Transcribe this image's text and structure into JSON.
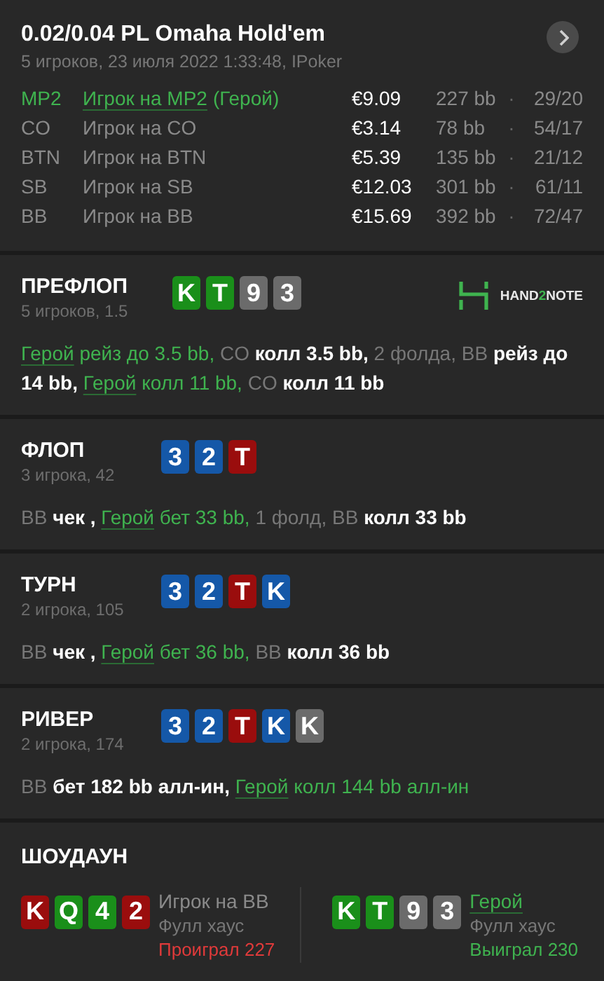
{
  "header": {
    "title": "0.02/0.04 PL Omaha Hold'em",
    "subtitle": "5 игроков, 23 июля 2022 1:33:48, IPoker"
  },
  "players": [
    {
      "position": "MP2",
      "name": "Игрок на MP2",
      "hero_tag": "(Герой)",
      "hero": true,
      "stack": "€9.09",
      "bb": "227 bb",
      "separator": "·",
      "stats": "29/20"
    },
    {
      "position": "CO",
      "name": "Игрок на CO",
      "hero": false,
      "stack": "€3.14",
      "bb": "78 bb",
      "separator": "·",
      "stats": "54/17"
    },
    {
      "position": "BTN",
      "name": "Игрок на BTN",
      "hero": false,
      "stack": "€5.39",
      "bb": "135 bb",
      "separator": "·",
      "stats": "21/12"
    },
    {
      "position": "SB",
      "name": "Игрок на SB",
      "hero": false,
      "stack": "€12.03",
      "bb": "301 bb",
      "separator": "·",
      "stats": "61/11"
    },
    {
      "position": "BB",
      "name": "Игрок на BB",
      "hero": false,
      "stack": "€15.69",
      "bb": "392 bb",
      "separator": "·",
      "stats": "72/47"
    }
  ],
  "logo": {
    "parts": [
      "HAND",
      "2",
      "NOTE"
    ]
  },
  "streets": [
    {
      "name": "ПРЕФЛОП",
      "info": "5 игроков, 1.5",
      "logo": true,
      "cards": [
        {
          "rank": "K",
          "color": "#1a8f1a"
        },
        {
          "rank": "T",
          "color": "#1a8f1a"
        },
        {
          "rank": "9",
          "color": "#6b6b6b"
        },
        {
          "rank": "3",
          "color": "#6b6b6b"
        }
      ],
      "actions": [
        {
          "text": "Герой",
          "kind": "hero"
        },
        {
          "text": "рейз до 3.5 bb,",
          "kind": "herobet"
        },
        {
          "text": "CO",
          "kind": "player"
        },
        {
          "text": "колл 3.5 bb,",
          "kind": "move"
        },
        {
          "text": "2 фолда,",
          "kind": "player"
        },
        {
          "text": "BB",
          "kind": "player"
        },
        {
          "text": "рейз до 14 bb,",
          "kind": "move"
        },
        {
          "text": "Герой",
          "kind": "hero"
        },
        {
          "text": "колл 11 bb,",
          "kind": "herobet"
        },
        {
          "text": "CO",
          "kind": "player"
        },
        {
          "text": "колл 11 bb",
          "kind": "move"
        }
      ]
    },
    {
      "name": "ФЛОП",
      "info": "3 игрока, 42",
      "logo": false,
      "cards": [
        {
          "rank": "3",
          "color": "#1558a8"
        },
        {
          "rank": "2",
          "color": "#1558a8"
        },
        {
          "rank": "T",
          "color": "#9a0d0d"
        }
      ],
      "actions": [
        {
          "text": "BB",
          "kind": "player"
        },
        {
          "text": "чек ,",
          "kind": "move"
        },
        {
          "text": "Герой",
          "kind": "hero"
        },
        {
          "text": "бет 33 bb,",
          "kind": "herobet"
        },
        {
          "text": "1 фолд,",
          "kind": "player"
        },
        {
          "text": "BB",
          "kind": "player"
        },
        {
          "text": "колл 33 bb",
          "kind": "move"
        }
      ]
    },
    {
      "name": "ТУРН",
      "info": "2 игрока, 105",
      "logo": false,
      "cards": [
        {
          "rank": "3",
          "color": "#1558a8"
        },
        {
          "rank": "2",
          "color": "#1558a8"
        },
        {
          "rank": "T",
          "color": "#9a0d0d"
        },
        {
          "rank": "K",
          "color": "#1558a8"
        }
      ],
      "actions": [
        {
          "text": "BB",
          "kind": "player"
        },
        {
          "text": "чек ,",
          "kind": "move"
        },
        {
          "text": "Герой",
          "kind": "hero"
        },
        {
          "text": "бет 36 bb,",
          "kind": "herobet"
        },
        {
          "text": "BB",
          "kind": "player"
        },
        {
          "text": "колл 36 bb",
          "kind": "move"
        }
      ]
    },
    {
      "name": "РИВЕР",
      "info": "2 игрока, 174",
      "logo": false,
      "cards": [
        {
          "rank": "3",
          "color": "#1558a8"
        },
        {
          "rank": "2",
          "color": "#1558a8"
        },
        {
          "rank": "T",
          "color": "#9a0d0d"
        },
        {
          "rank": "K",
          "color": "#1558a8"
        },
        {
          "rank": "K",
          "color": "#6b6b6b"
        }
      ],
      "actions": [
        {
          "text": "BB",
          "kind": "player"
        },
        {
          "text": "бет 182 bb алл-ин,",
          "kind": "move"
        },
        {
          "text": "Герой",
          "kind": "hero"
        },
        {
          "text": "колл 144 bb алл-ин",
          "kind": "herobet"
        }
      ]
    }
  ],
  "showdown": {
    "title": "ШОУДАУН",
    "hands": [
      {
        "cards": [
          {
            "rank": "K",
            "color": "#9a0d0d"
          },
          {
            "rank": "Q",
            "color": "#1a8f1a"
          },
          {
            "rank": "4",
            "color": "#1a8f1a"
          },
          {
            "rank": "2",
            "color": "#9a0d0d"
          }
        ],
        "name": "Игрок на BB",
        "hero": false,
        "hand": "Фулл хаус",
        "result": "Проиграл 227",
        "won": false
      },
      {
        "cards": [
          {
            "rank": "K",
            "color": "#1a8f1a"
          },
          {
            "rank": "T",
            "color": "#1a8f1a"
          },
          {
            "rank": "9",
            "color": "#6b6b6b"
          },
          {
            "rank": "3",
            "color": "#6b6b6b"
          }
        ],
        "name": "Герой",
        "hero": true,
        "hand": "Фулл хаус",
        "result": "Выиграл 230",
        "won": true
      }
    ]
  }
}
